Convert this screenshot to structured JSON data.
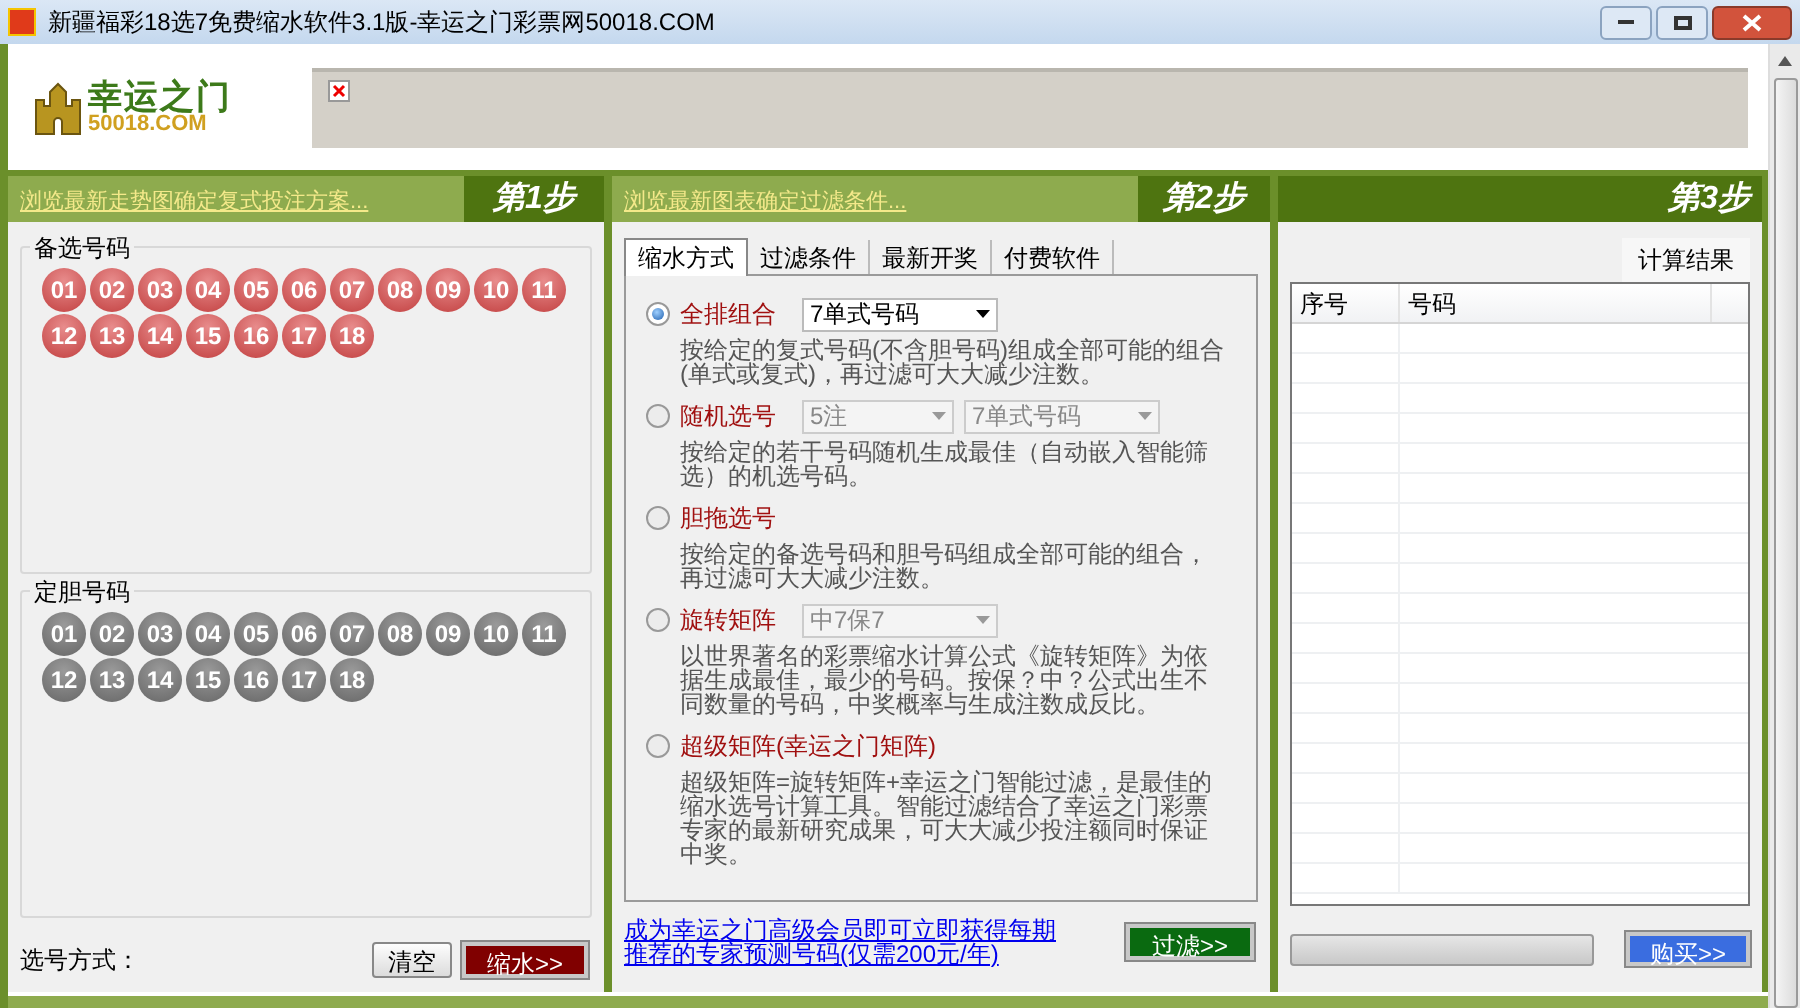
{
  "window": {
    "title": "新疆福彩18选7免费缩水软件3.1版-幸运之门彩票网50018.COM"
  },
  "logo": {
    "name": "幸运之门",
    "domain": "50018.COM"
  },
  "steps": [
    {
      "label": "第1步",
      "link": "浏览最新走势图确定复式投注方案..."
    },
    {
      "label": "第2步",
      "link": "浏览最新图表确定过滤条件..."
    },
    {
      "label": "第3步"
    }
  ],
  "number_groups": [
    {
      "label": "备选号码",
      "kind": "candidate",
      "balls": [
        "01",
        "02",
        "03",
        "04",
        "05",
        "06",
        "07",
        "08",
        "09",
        "10",
        "11",
        "12",
        "13",
        "14",
        "15",
        "16",
        "17",
        "18"
      ]
    },
    {
      "label": "定胆号码",
      "kind": "banker",
      "balls": [
        "01",
        "02",
        "03",
        "04",
        "05",
        "06",
        "07",
        "08",
        "09",
        "10",
        "11",
        "12",
        "13",
        "14",
        "15",
        "16",
        "17",
        "18"
      ]
    }
  ],
  "pick_method_label": "选号方式：",
  "left_buttons": [
    {
      "label": "清空",
      "kind": "plain"
    },
    {
      "label": "缩水>>",
      "kind": "primary"
    }
  ],
  "tabs": [
    {
      "label": "缩水方式",
      "selected": true
    },
    {
      "label": "过滤条件",
      "selected": false
    },
    {
      "label": "最新开奖",
      "selected": false
    },
    {
      "label": "付费软件",
      "selected": false
    }
  ],
  "options": [
    {
      "label": "全排组合",
      "selected": true,
      "dropdowns": [
        {
          "value": "7单式号码",
          "disabled": false
        }
      ],
      "description": "按给定的复式号码(不含胆号码)组成全部可能的组合(单式或复式)，再过滤可大大减少注数。"
    },
    {
      "label": "随机选号",
      "selected": false,
      "dropdowns": [
        {
          "value": "5注",
          "disabled": true
        },
        {
          "value": "7单式号码",
          "disabled": true
        }
      ],
      "description": "按给定的若干号码随机生成最佳（自动嵌入智能筛选）的机选号码。"
    },
    {
      "label": "胆拖选号",
      "selected": false,
      "description": "按给定的备选号码和胆号码组成全部可能的组合，再过滤可大大减少注数。"
    },
    {
      "label": "旋转矩阵",
      "selected": false,
      "dropdowns": [
        {
          "value": "中7保7",
          "disabled": true
        }
      ],
      "description": "以世界著名的彩票缩水计算公式《旋转矩阵》为依据生成最佳，最少的号码。按保？中？公式出生不同数量的号码，中奖概率与生成注数成反比。"
    },
    {
      "label": "超级矩阵(幸运之门矩阵)",
      "selected": false,
      "description": "超级矩阵=旋转矩阵+幸运之门智能过滤，是最佳的缩水选号计算工具。智能过滤结合了幸运之门彩票专家的最新研究成果，可大大减少投注额同时保证中奖。"
    }
  ],
  "member_link": [
    "成为幸运之门高级会员即可立即获得每期",
    "推荐的专家预测号码(仅需200元/年)"
  ],
  "filter_button": "过滤>>",
  "results": {
    "label": "计算结果",
    "columns": [
      "序号",
      "号码"
    ]
  },
  "progress": {
    "level": 0
  },
  "buy_button": "购买>>"
}
